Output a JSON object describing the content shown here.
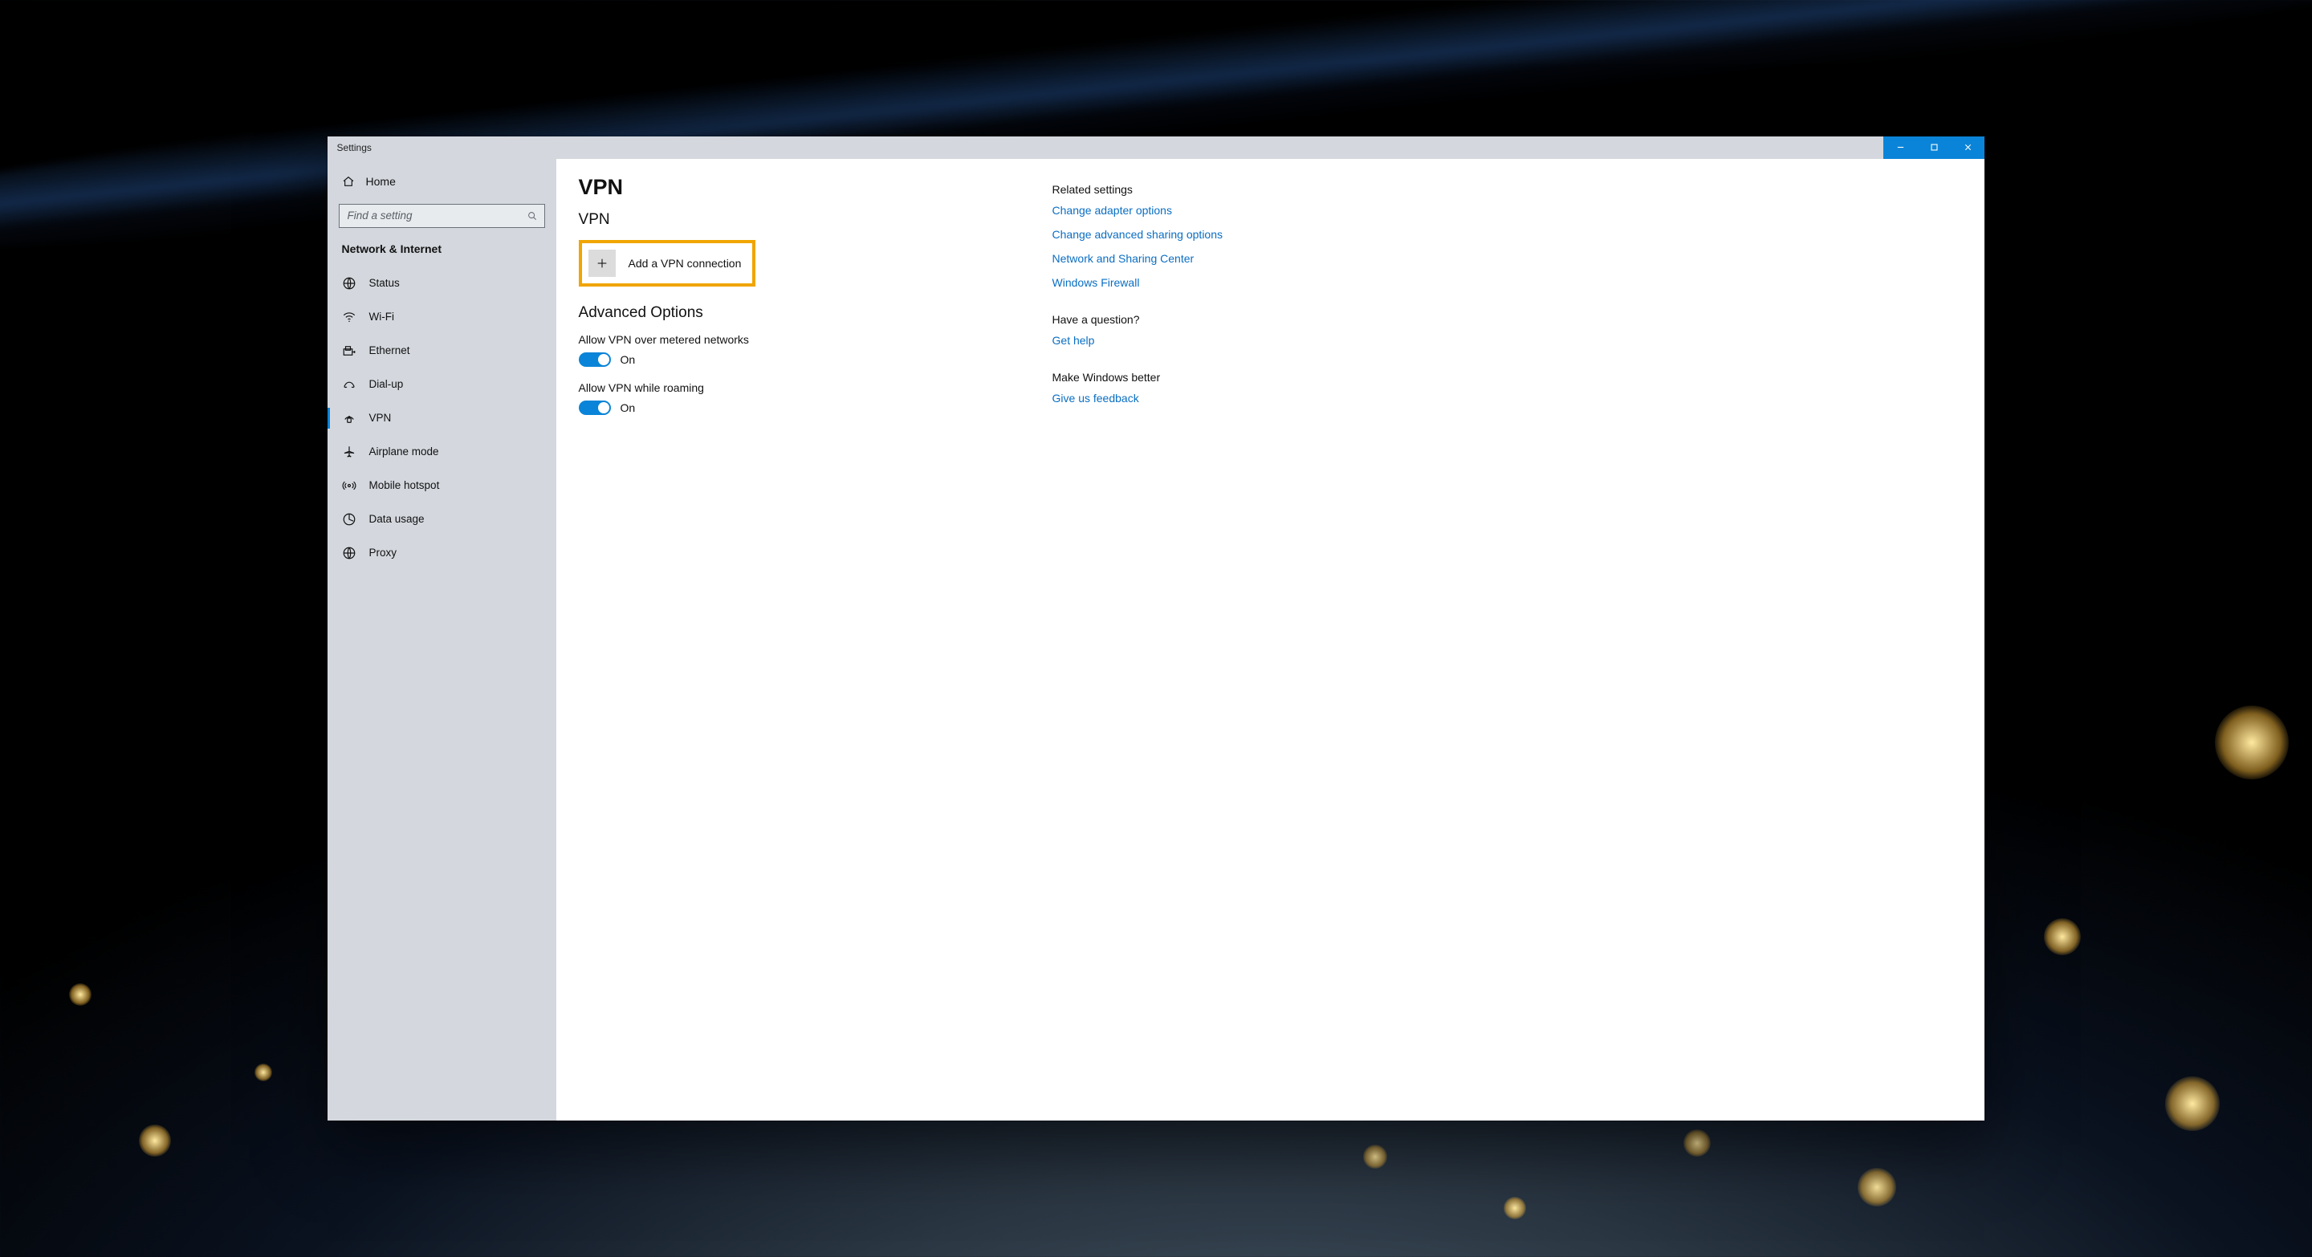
{
  "window": {
    "title": "Settings"
  },
  "sidebar": {
    "home_label": "Home",
    "search_placeholder": "Find a setting",
    "section_title": "Network & Internet",
    "items": [
      {
        "label": "Status"
      },
      {
        "label": "Wi-Fi"
      },
      {
        "label": "Ethernet"
      },
      {
        "label": "Dial-up"
      },
      {
        "label": "VPN",
        "selected": true
      },
      {
        "label": "Airplane mode"
      },
      {
        "label": "Mobile hotspot"
      },
      {
        "label": "Data usage"
      },
      {
        "label": "Proxy"
      }
    ]
  },
  "main": {
    "page_title": "VPN",
    "section1_title": "VPN",
    "add_button_label": "Add a VPN connection",
    "advanced_title": "Advanced Options",
    "options": [
      {
        "label": "Allow VPN over metered networks",
        "state": "On"
      },
      {
        "label": "Allow VPN while roaming",
        "state": "On"
      }
    ]
  },
  "aside": {
    "related_title": "Related settings",
    "related_links": [
      "Change adapter options",
      "Change advanced sharing options",
      "Network and Sharing Center",
      "Windows Firewall"
    ],
    "question_title": "Have a question?",
    "help_link": "Get help",
    "feedback_title": "Make Windows better",
    "feedback_link": "Give us feedback"
  },
  "colors": {
    "accent": "#0a84d8",
    "highlight_border": "#f0a500"
  }
}
